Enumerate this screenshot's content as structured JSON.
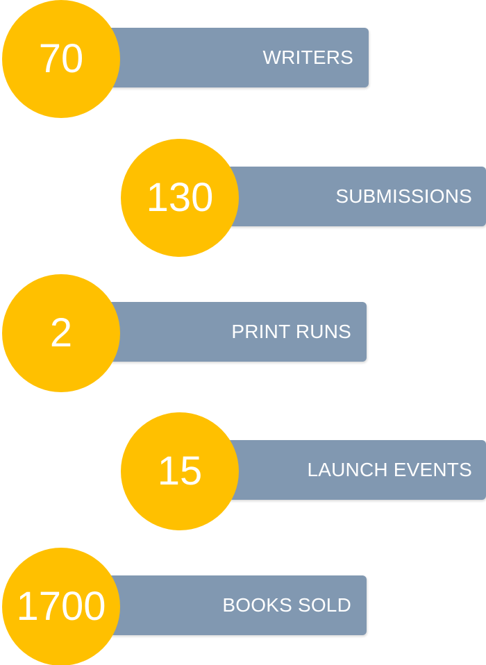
{
  "colors": {
    "circle": "#FFC000",
    "label_box": "#8198B1",
    "text": "#FFFFFF"
  },
  "stats": [
    {
      "value": "70",
      "label": "WRITERS"
    },
    {
      "value": "130",
      "label": "SUBMISSIONS"
    },
    {
      "value": "2",
      "label": "PRINT RUNS"
    },
    {
      "value": "15",
      "label": "LAUNCH EVENTS"
    },
    {
      "value": "1700",
      "label": "BOOKS SOLD"
    }
  ]
}
